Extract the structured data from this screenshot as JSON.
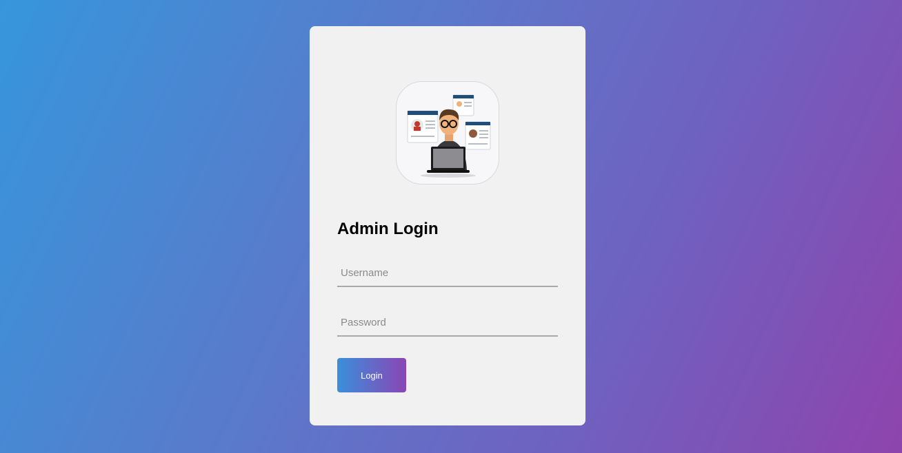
{
  "login_card": {
    "title": "Admin Login",
    "avatar_icon": "admin-with-laptop-illustration",
    "username": {
      "value": "",
      "placeholder": "Username"
    },
    "password": {
      "value": "",
      "placeholder": "Password"
    },
    "login_button_label": "Login"
  },
  "colors": {
    "background_start": "#3696dc",
    "background_end": "#8e44ad",
    "card": "#f1f1f1",
    "button_start": "#3a8fdb",
    "button_end": "#8a46b4"
  }
}
